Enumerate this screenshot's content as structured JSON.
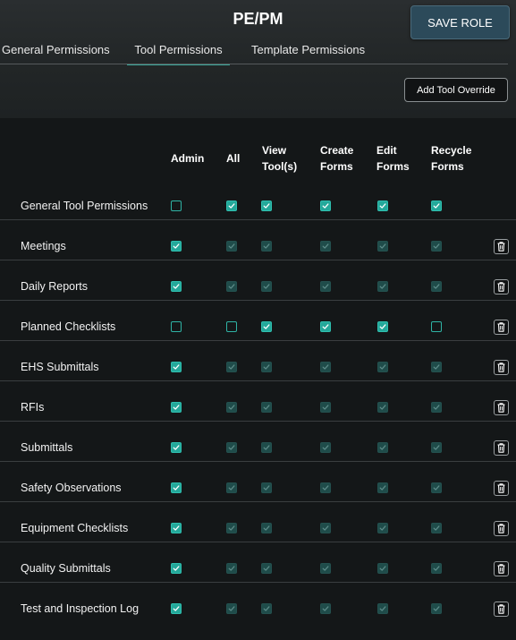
{
  "header": {
    "role_name": "PE/PM",
    "save_label": "SAVE ROLE"
  },
  "tabs": [
    {
      "label": "General Permissions",
      "active": false
    },
    {
      "label": "Tool Permissions",
      "active": true
    },
    {
      "label": "Template Permissions",
      "active": false
    }
  ],
  "toolbar": {
    "add_override_label": "Add Tool Override"
  },
  "columns": [
    {
      "line1": "Admin",
      "line2": ""
    },
    {
      "line1": "All",
      "line2": ""
    },
    {
      "line1": "View",
      "line2": "Tool(s)"
    },
    {
      "line1": "Create",
      "line2": "Forms"
    },
    {
      "line1": "Edit",
      "line2": "Forms"
    },
    {
      "line1": "Recycle",
      "line2": "Forms"
    }
  ],
  "rows": [
    {
      "label": "General Tool Permissions",
      "states": [
        "off",
        "on",
        "on",
        "on",
        "on",
        "on"
      ],
      "deletable": false
    },
    {
      "label": "Meetings",
      "states": [
        "on",
        "dis",
        "dis",
        "dis",
        "dis",
        "dis"
      ],
      "deletable": true
    },
    {
      "label": "Daily Reports",
      "states": [
        "on",
        "dis",
        "dis",
        "dis",
        "dis",
        "dis"
      ],
      "deletable": true
    },
    {
      "label": "Planned Checklists",
      "states": [
        "off",
        "off",
        "on",
        "on",
        "on",
        "off"
      ],
      "deletable": true
    },
    {
      "label": "EHS Submittals",
      "states": [
        "on",
        "dis",
        "dis",
        "dis",
        "dis",
        "dis"
      ],
      "deletable": true
    },
    {
      "label": "RFIs",
      "states": [
        "on",
        "dis",
        "dis",
        "dis",
        "dis",
        "dis"
      ],
      "deletable": true
    },
    {
      "label": "Submittals",
      "states": [
        "on",
        "dis",
        "dis",
        "dis",
        "dis",
        "dis"
      ],
      "deletable": true
    },
    {
      "label": "Safety Observations",
      "states": [
        "on",
        "dis",
        "dis",
        "dis",
        "dis",
        "dis"
      ],
      "deletable": true
    },
    {
      "label": "Equipment Checklists",
      "states": [
        "on",
        "dis",
        "dis",
        "dis",
        "dis",
        "dis"
      ],
      "deletable": true
    },
    {
      "label": "Quality Submittals",
      "states": [
        "on",
        "dis",
        "dis",
        "dis",
        "dis",
        "dis"
      ],
      "deletable": true
    },
    {
      "label": "Test and Inspection Log",
      "states": [
        "on",
        "dis",
        "dis",
        "dis",
        "dis",
        "dis"
      ],
      "deletable": true
    }
  ],
  "colors": {
    "accent": "#24a89a",
    "disabled_check": "#1f4c4a",
    "save_button": "#2c4a5a"
  }
}
